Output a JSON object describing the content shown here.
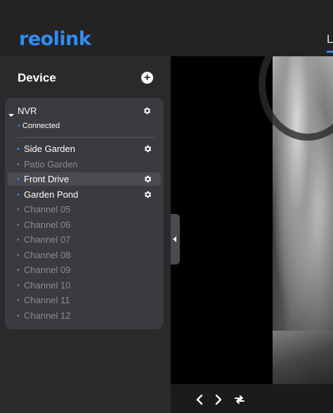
{
  "header": {
    "logo_text": "reolink",
    "tab_live": "L"
  },
  "sidebar": {
    "title": "Device",
    "add_icon": "plus-circle-icon",
    "nvr": {
      "name": "NVR",
      "status": "Connected"
    },
    "channels": [
      {
        "label": "Side Garden",
        "online": true,
        "selected": false,
        "settings": true
      },
      {
        "label": "Patio Garden",
        "online": false,
        "selected": false,
        "settings": false
      },
      {
        "label": "Front Drive",
        "online": true,
        "selected": true,
        "settings": true
      },
      {
        "label": "Garden Pond",
        "online": true,
        "selected": false,
        "settings": true
      },
      {
        "label": "Channel 05",
        "online": false,
        "selected": false,
        "settings": false
      },
      {
        "label": "Channel 06",
        "online": false,
        "selected": false,
        "settings": false
      },
      {
        "label": "Channel 07",
        "online": false,
        "selected": false,
        "settings": false
      },
      {
        "label": "Channel 08",
        "online": false,
        "selected": false,
        "settings": false
      },
      {
        "label": "Channel 09",
        "online": false,
        "selected": false,
        "settings": false
      },
      {
        "label": "Channel 10",
        "online": false,
        "selected": false,
        "settings": false
      },
      {
        "label": "Channel 11",
        "online": false,
        "selected": false,
        "settings": false
      },
      {
        "label": "Channel 12",
        "online": false,
        "selected": false,
        "settings": false
      }
    ]
  },
  "colors": {
    "accent": "#2f8cf3",
    "online_dot": "#2f8cf3",
    "offline_text": "#8b8b8f"
  }
}
